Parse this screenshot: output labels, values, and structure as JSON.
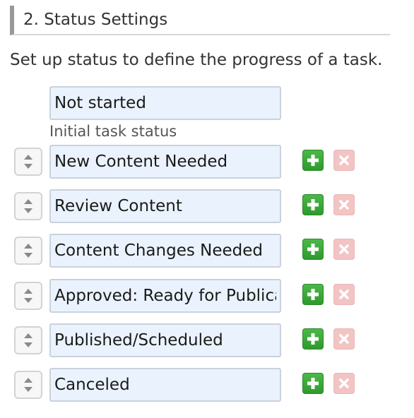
{
  "section": {
    "title": "2. Status Settings",
    "description": "Set up status to define the progress of a task."
  },
  "initial_status": {
    "value": "Not started",
    "hint": "Initial task status"
  },
  "statuses": [
    {
      "value": "New Content Needed"
    },
    {
      "value": "Review Content"
    },
    {
      "value": "Content Changes Needed"
    },
    {
      "value": "Approved: Ready for Publication"
    },
    {
      "value": "Published/Scheduled"
    },
    {
      "value": "Canceled"
    }
  ],
  "icons": {
    "sort_handle": "up-down-arrows-icon",
    "add": "plus-icon",
    "remove": "x-icon"
  },
  "colors": {
    "input_background": "#eaf3fd",
    "add_button": "#3caa3a",
    "remove_button": "#f2c4c4",
    "header_bar": "#999999"
  }
}
